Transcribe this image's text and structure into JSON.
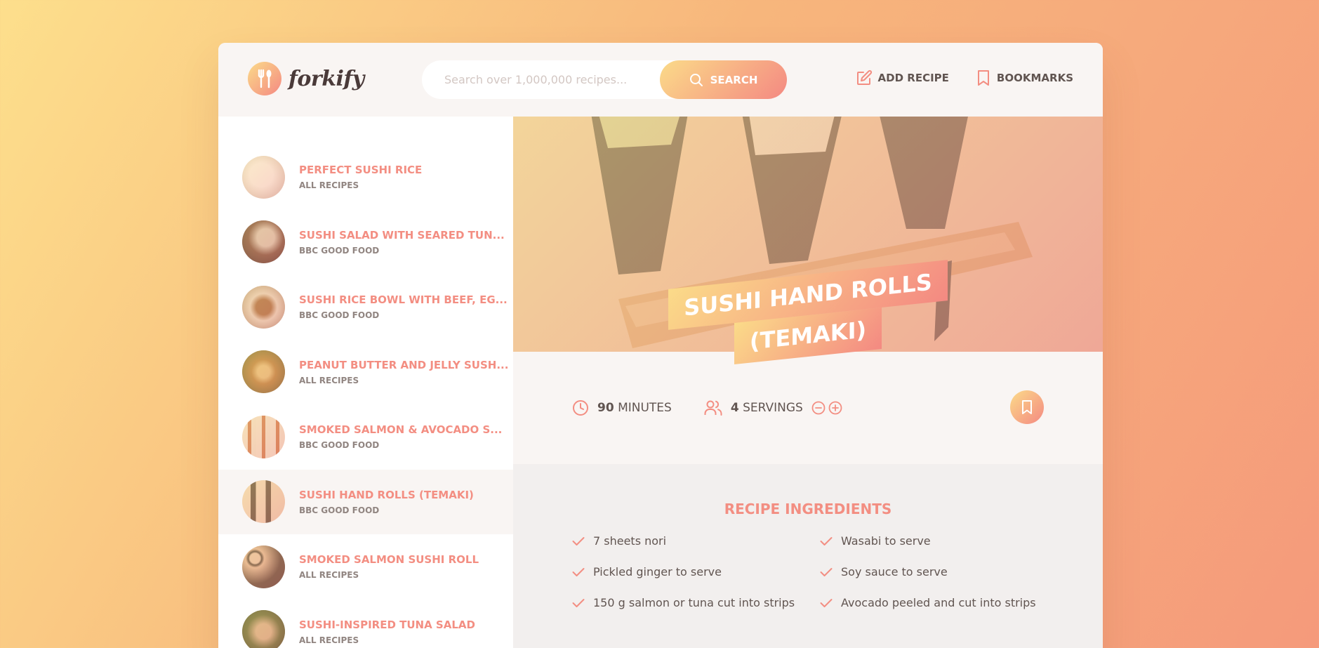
{
  "header": {
    "logo_text": "forkify",
    "search_placeholder": "Search over 1,000,000 recipes...",
    "search_button": "SEARCH",
    "nav": {
      "add_recipe": "ADD RECIPE",
      "bookmarks": "BOOKMARKS"
    }
  },
  "results": [
    {
      "title": "PERFECT SUSHI RICE",
      "publisher": "ALL RECIPES",
      "thumb": "#efe6dc"
    },
    {
      "title": "SUSHI SALAD WITH SEARED TUN...",
      "publisher": "BBC GOOD FOOD",
      "thumb": "#6b4a3a"
    },
    {
      "title": "SUSHI RICE BOWL WITH BEEF, EG...",
      "publisher": "BBC GOOD FOOD",
      "thumb": "#c9a27d"
    },
    {
      "title": "PEANUT BUTTER AND JELLY SUSH...",
      "publisher": "ALL RECIPES",
      "thumb": "#a98a3e"
    },
    {
      "title": "SMOKED SALMON & AVOCADO S...",
      "publisher": "BBC GOOD FOOD",
      "thumb": "#e8c6a6"
    },
    {
      "title": "SUSHI HAND ROLLS (TEMAKI)",
      "publisher": "BBC GOOD FOOD",
      "thumb": "#d9b48c",
      "active": true
    },
    {
      "title": "SMOKED SALMON SUSHI ROLL",
      "publisher": "ALL RECIPES",
      "thumb": "#8a6a55"
    },
    {
      "title": "SUSHI-INSPIRED TUNA SALAD",
      "publisher": "ALL RECIPES",
      "thumb": "#6f6a3e"
    }
  ],
  "recipe": {
    "title_line1": "SUSHI HAND ROLLS",
    "title_line2": "(TEMAKI)",
    "time_value": "90",
    "time_unit": "MINUTES",
    "servings_value": "4",
    "servings_unit": "SERVINGS",
    "ingredients_heading": "RECIPE INGREDIENTS",
    "ingredients": [
      "7 sheets nori",
      "Wasabi to serve",
      "Pickled ginger to serve",
      "Soy sauce to serve",
      "150 g salmon or tuna cut into strips",
      "Avocado peeled and cut into strips"
    ]
  },
  "colors": {
    "accent": "#f38e82",
    "gradient_start": "#fbdb89",
    "gradient_end": "#f48982"
  }
}
